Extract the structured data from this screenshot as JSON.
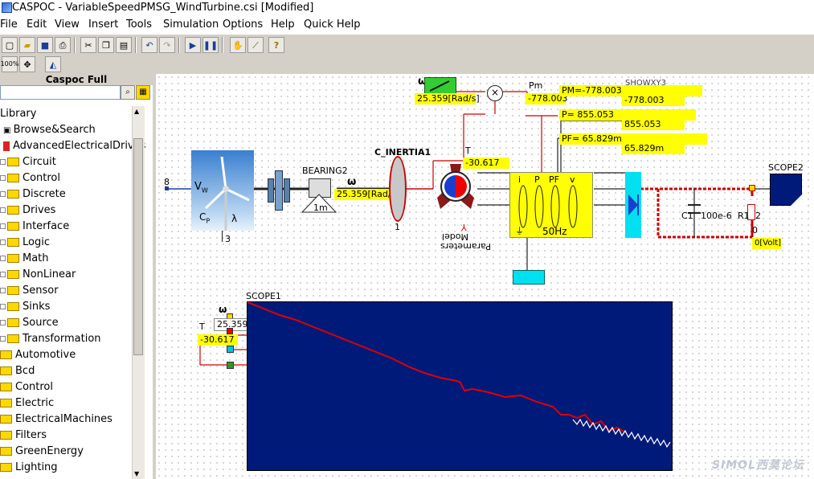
{
  "window": {
    "title": "CASPOC - VariableSpeedPMSG_WindTurbine.csi [Modified]"
  },
  "menu": [
    "File",
    "Edit",
    "View",
    "Insert",
    "Tools",
    "Simulation",
    "Options",
    "Help",
    "Quick Help"
  ],
  "toolbar": {
    "zoom_label": "100%"
  },
  "sidebar": {
    "header": "Caspoc Full",
    "search_placeholder": "",
    "items": [
      {
        "label": "Library",
        "level": 0,
        "icon": "none"
      },
      {
        "label": "Browse&Search",
        "level": 1,
        "icon": "browse-icon"
      },
      {
        "label": "AdvancedElectricalDrives",
        "level": 1,
        "icon": "drives-icon"
      },
      {
        "label": "Circuit",
        "level": 2,
        "icon": "folder-icon"
      },
      {
        "label": "Control",
        "level": 2,
        "icon": "folder-icon"
      },
      {
        "label": "Discrete",
        "level": 2,
        "icon": "folder-icon"
      },
      {
        "label": "Drives",
        "level": 2,
        "icon": "folder-icon"
      },
      {
        "label": "Interface",
        "level": 2,
        "icon": "folder-icon"
      },
      {
        "label": "Logic",
        "level": 2,
        "icon": "folder-icon"
      },
      {
        "label": "Math",
        "level": 2,
        "icon": "folder-icon"
      },
      {
        "label": "NonLinear",
        "level": 2,
        "icon": "folder-icon"
      },
      {
        "label": "Sensor",
        "level": 2,
        "icon": "folder-icon"
      },
      {
        "label": "Sinks",
        "level": 2,
        "icon": "folder-icon"
      },
      {
        "label": "Source",
        "level": 2,
        "icon": "folder-icon"
      },
      {
        "label": "Transformation",
        "level": 2,
        "icon": "folder-icon"
      },
      {
        "label": "Automotive",
        "level": 1,
        "icon": "folder-icon"
      },
      {
        "label": "Bcd",
        "level": 1,
        "icon": "folder-icon"
      },
      {
        "label": "Control",
        "level": 1,
        "icon": "folder-icon"
      },
      {
        "label": "Electric",
        "level": 1,
        "icon": "folder-icon"
      },
      {
        "label": "ElectricalMachines",
        "level": 1,
        "icon": "folder-icon"
      },
      {
        "label": "Filters",
        "level": 1,
        "icon": "folder-icon"
      },
      {
        "label": "GreenEnergy",
        "level": 1,
        "icon": "folder-icon"
      },
      {
        "label": "Lighting",
        "level": 1,
        "icon": "folder-icon"
      }
    ]
  },
  "schematic": {
    "wind_input": "8",
    "wind_label": "V",
    "wind_sub": "W",
    "cp_label": "C",
    "cp_sub": "P",
    "lambda_label": "λ",
    "node3": "3",
    "bearing_name": "BEARING2",
    "bearing_value": "1m",
    "omega_symbol": "ω",
    "omega_box": "25.359[Rad/s]",
    "inertia_name": "C_INERTIA1",
    "inertia_node": "1",
    "torque_label": "T",
    "torque_value": "-30.617",
    "model_label": "Model",
    "model_params": "Parameters",
    "omega_top_box": "25.359[Rad/s]",
    "pm_label": "Pm",
    "pm_value": "-778.003",
    "pm_readout": "PM=-778.003",
    "pm_readout2": "-778.003",
    "show_label": "SHOWXY3",
    "p_readout": "P= 855.053",
    "p_readout2": "855.053",
    "pf_readout": "PF= 65.829m",
    "pf_readout2": "65.829m",
    "meter_i": "i",
    "meter_p": "P",
    "meter_pf": "PF",
    "meter_v": "v",
    "freq": "50Hz",
    "cap_name": "C1",
    "cap_value": "100e-6",
    "res_name": "R1",
    "res_node": "2",
    "node0": "0",
    "volt_box": "0[Volt]",
    "scope2": "SCOPE2",
    "scope1": "SCOPE1",
    "scope_omega_box": "25.359[Rad/s]",
    "scope_torque_value": "-30.617"
  },
  "watermark": "SIMOL西莫论坛",
  "colors": {
    "scope_bg": "#001a7a",
    "trace_red": "#e00000",
    "trace_white": "#ffffff",
    "readout_yellow": "#ffff00",
    "cyan": "#00e0f0"
  }
}
